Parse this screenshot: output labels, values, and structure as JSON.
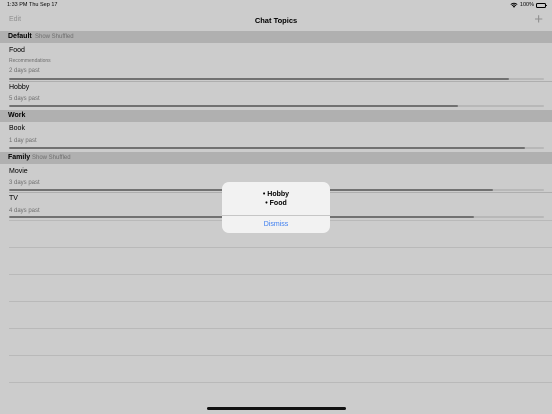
{
  "status_bar": {
    "time": "1:33 PM",
    "date": "Thu Sep 17",
    "wifi_icon": "wifi-icon",
    "battery_label": "100%",
    "battery_level": 1.0
  },
  "nav": {
    "edit_label": "Edit",
    "title": "Chat Topics",
    "add_label": "+"
  },
  "sections": [
    {
      "title": "Default",
      "action": "Show Shuffled",
      "rows": [
        {
          "title": "Food",
          "subtitle": "Recommendations",
          "meta": "2 days past",
          "progress": 0.935
        },
        {
          "title": "Hobby",
          "subtitle": "",
          "meta": "5 days past",
          "progress": 0.84
        }
      ]
    },
    {
      "title": "Work",
      "action": "",
      "rows": [
        {
          "title": "Book",
          "subtitle": "",
          "meta": "1 day past",
          "progress": 0.965
        }
      ]
    },
    {
      "title": "Family",
      "action": "Show Shuffled",
      "rows": [
        {
          "title": "Movie",
          "subtitle": "",
          "meta": "3 days past",
          "progress": 0.905
        },
        {
          "title": "TV",
          "subtitle": "",
          "meta": "4 days past",
          "progress": 0.87
        }
      ]
    }
  ],
  "alert": {
    "items": [
      "• Hobby",
      "• Food"
    ],
    "dismiss_label": "Dismiss"
  }
}
